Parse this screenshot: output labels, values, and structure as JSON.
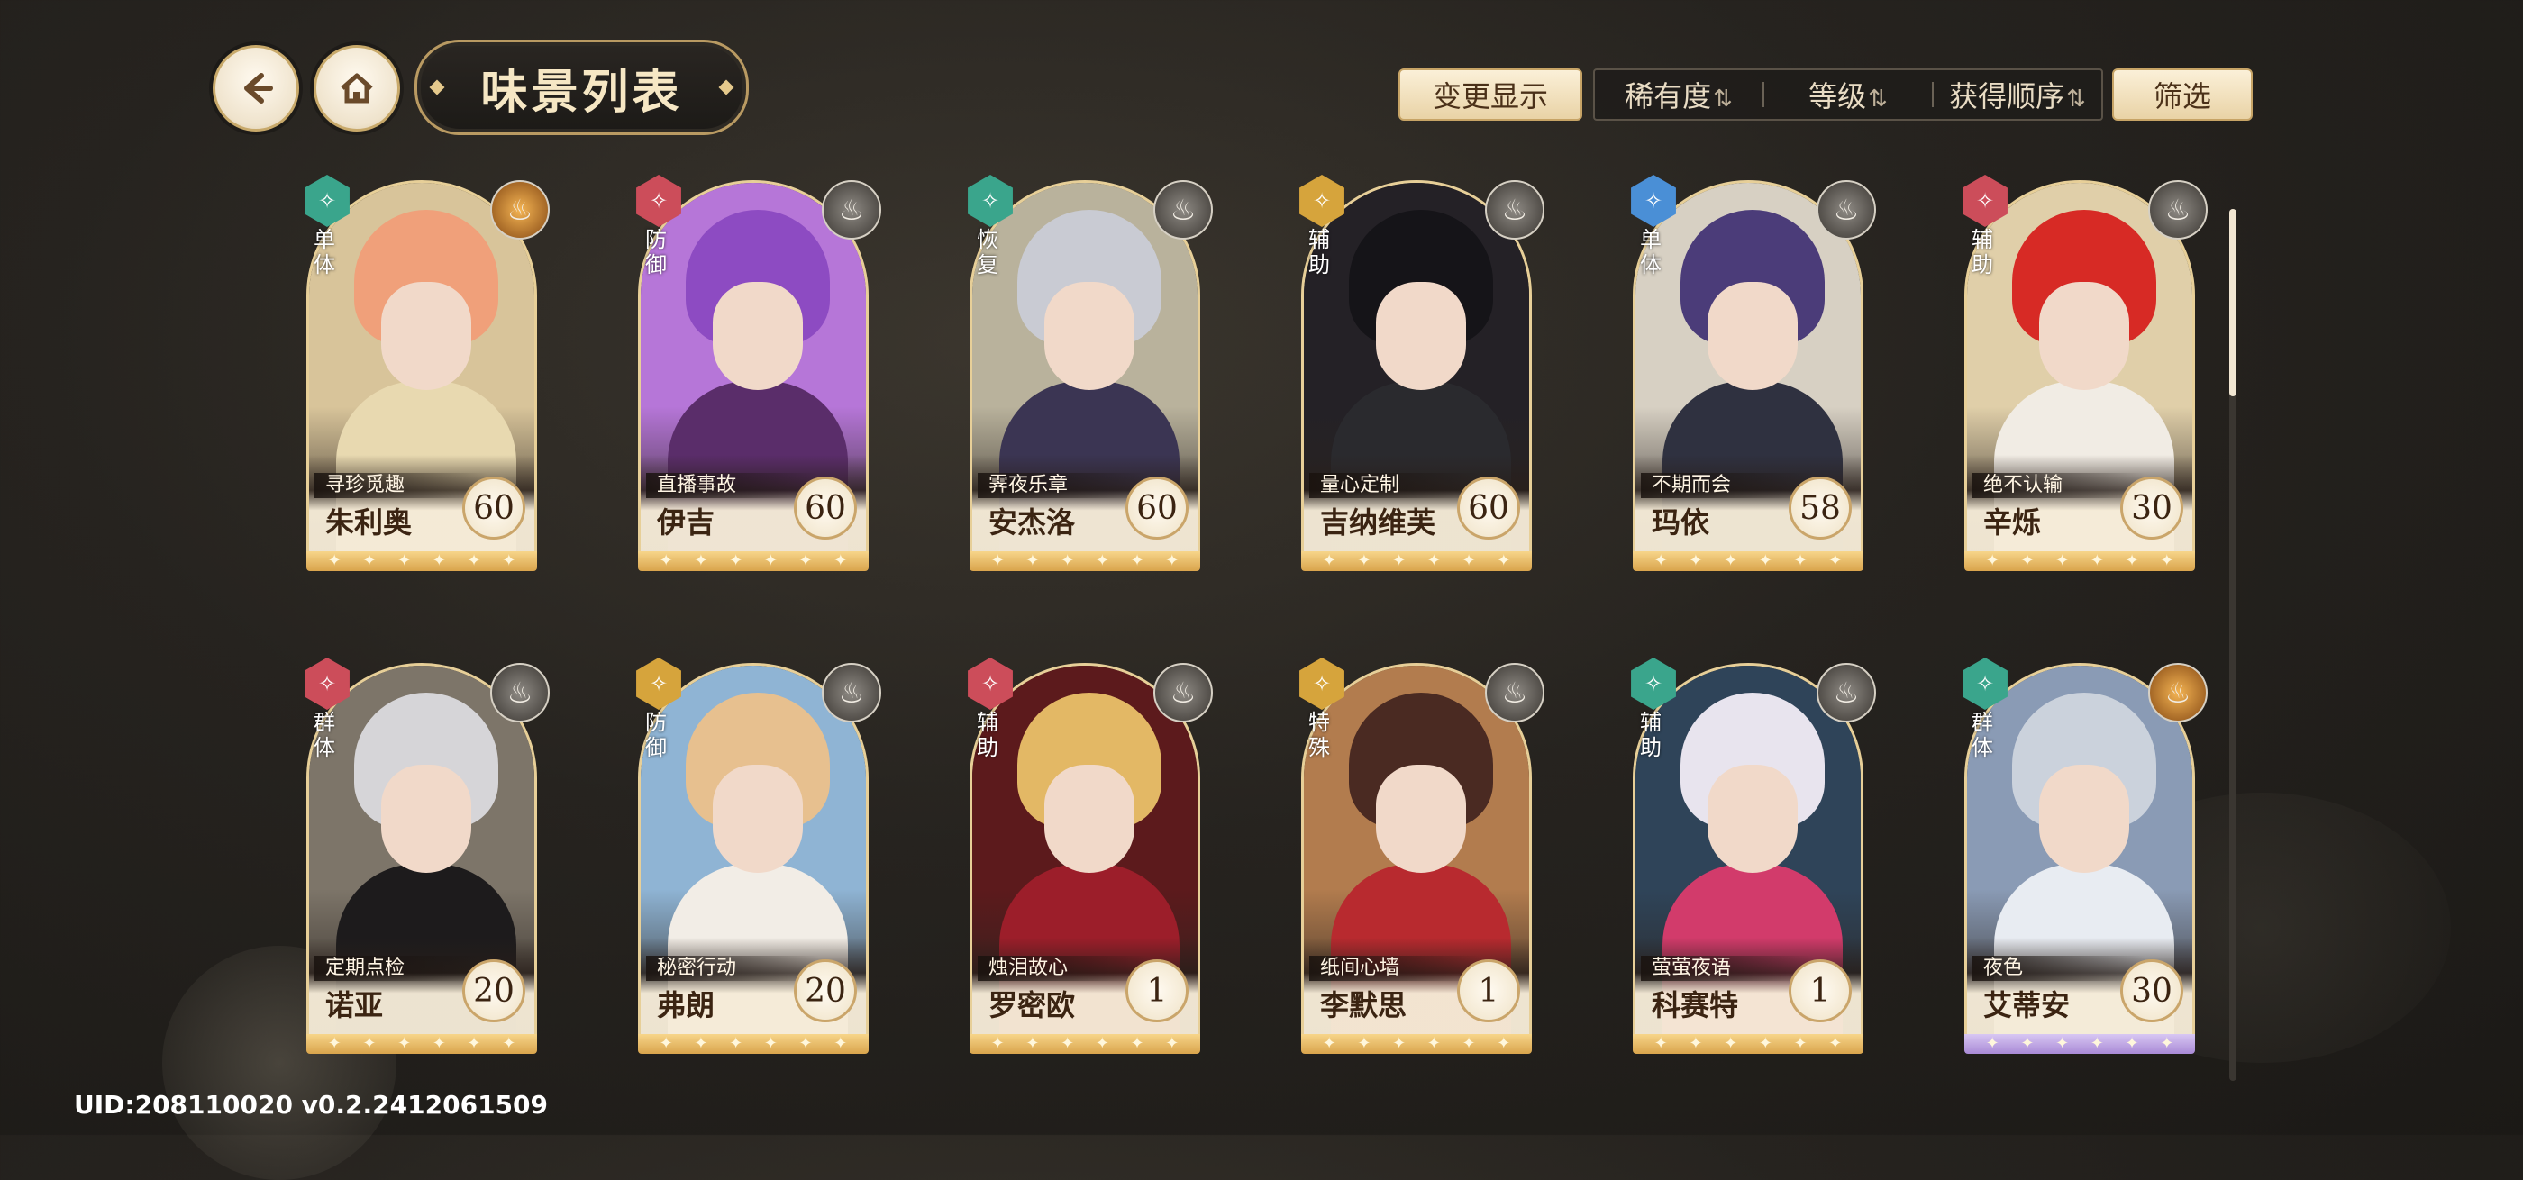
{
  "header": {
    "back_icon": "arrow-left-icon",
    "home_icon": "home-icon",
    "title": "味景列表",
    "change_display_label": "变更显示",
    "sort_options": [
      {
        "label": "稀有度",
        "arrow": "⇅"
      },
      {
        "label": "等级",
        "arrow": "⇅"
      },
      {
        "label": "获得顺序",
        "arrow": "⇅"
      }
    ],
    "filter_label": "筛选"
  },
  "cards": [
    {
      "name": "朱利奥",
      "subtitle": "寻珍觅趣",
      "level": "60",
      "role": "单体",
      "role_color": "#3aa58c",
      "hair": "#f0a07a",
      "outfit": "#e8d9b0",
      "bg": "#d8c49a",
      "element_icon": "flame-icon",
      "element_color": "orange",
      "stars": "purple-no"
    },
    {
      "name": "伊吉",
      "subtitle": "直播事故",
      "level": "60",
      "role": "防御",
      "role_color": "#cc4d5a",
      "hair": "#8d4bc2",
      "outfit": "#5a2d6a",
      "bg": "#b676d8",
      "element_icon": "flame-icon",
      "element_color": "grey"
    },
    {
      "name": "安杰洛",
      "subtitle": "霁夜乐章",
      "level": "60",
      "role": "恢复",
      "role_color": "#3aa58c",
      "hair": "#c9cbd3",
      "outfit": "#3b3553",
      "bg": "#b9b29c",
      "element_icon": "flame-icon",
      "element_color": "grey"
    },
    {
      "name": "吉纳维芙",
      "subtitle": "量心定制",
      "level": "60",
      "role": "辅助",
      "role_color": "#d6a43c",
      "hair": "#151418",
      "outfit": "#2a2a2e",
      "bg": "#242126",
      "element_icon": "flame-icon",
      "element_color": "grey"
    },
    {
      "name": "玛依",
      "subtitle": "不期而会",
      "level": "58",
      "role": "单体",
      "role_color": "#4a8fd6",
      "hair": "#4b3c79",
      "outfit": "#2f3140",
      "bg": "#d7d0c3",
      "element_icon": "flame-icon",
      "element_color": "grey"
    },
    {
      "name": "辛烁",
      "subtitle": "绝不认输",
      "level": "30",
      "role": "辅助",
      "role_color": "#cc4d5a",
      "hair": "#d72a25",
      "outfit": "#f1ece4",
      "bg": "#e0cfa9",
      "element_icon": "flame-icon",
      "element_color": "grey"
    },
    {
      "name": "诺亚",
      "subtitle": "定期点检",
      "level": "20",
      "role": "群体",
      "role_color": "#cc4d5a",
      "hair": "#d6d5d8",
      "outfit": "#1d1b1c",
      "bg": "#7d7569",
      "element_icon": "flame-icon",
      "element_color": "grey"
    },
    {
      "name": "弗朗",
      "subtitle": "秘密行动",
      "level": "20",
      "role": "防御",
      "role_color": "#d6a43c",
      "hair": "#e7c08f",
      "outfit": "#f2ede6",
      "bg": "#8fb4d4",
      "element_icon": "flame-icon",
      "element_color": "grey"
    },
    {
      "name": "罗密欧",
      "subtitle": "烛泪故心",
      "level": "1",
      "role": "辅助",
      "role_color": "#cc4d5a",
      "hair": "#e3b865",
      "outfit": "#9c1e2a",
      "bg": "#5c1a1c",
      "element_icon": "flame-icon",
      "element_color": "grey"
    },
    {
      "name": "李默思",
      "subtitle": "纸间心墙",
      "level": "1",
      "role": "特殊",
      "role_color": "#d6a43c",
      "hair": "#4a2a22",
      "outfit": "#b82a2f",
      "bg": "#b27c4e",
      "element_icon": "flame-icon",
      "element_color": "grey"
    },
    {
      "name": "科赛特",
      "subtitle": "萤萤夜语",
      "level": "1",
      "role": "辅助",
      "role_color": "#3aa58c",
      "hair": "#e8e4ee",
      "outfit": "#d23b6b",
      "bg": "#2f4459",
      "element_icon": "flame-icon",
      "element_color": "grey"
    },
    {
      "name": "艾蒂安",
      "subtitle": "夜色",
      "level": "30",
      "role": "群体",
      "role_color": "#3aa58c",
      "hair": "#cbd2dc",
      "outfit": "#e8ecf2",
      "bg": "#8a9bb5",
      "element_icon": "flame-icon",
      "element_color": "orange",
      "stars": "purple"
    }
  ],
  "footer": {
    "uid_text": "UID:208110020  v0.2.2412061509"
  }
}
